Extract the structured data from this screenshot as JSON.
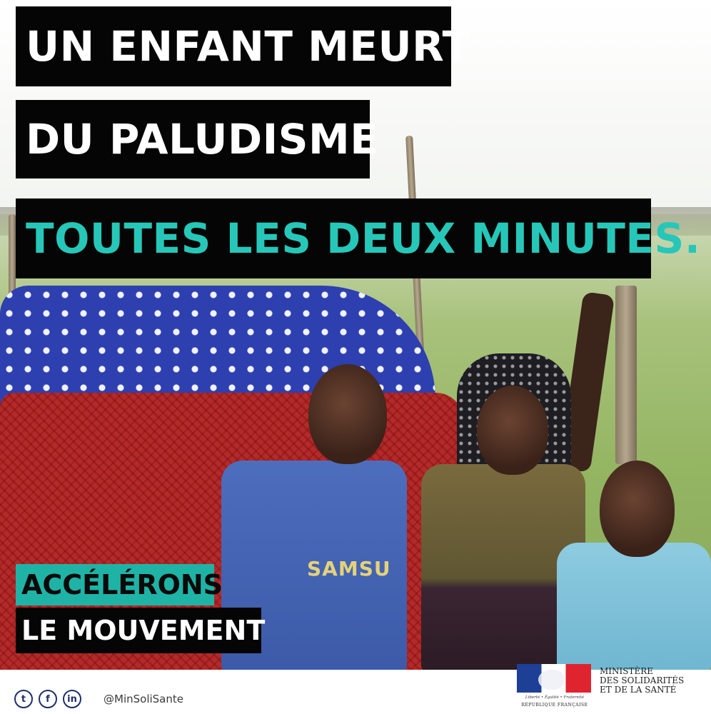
{
  "headline": {
    "line1": "UN ENFANT MEURT",
    "line2": "DU PALUDISME",
    "line3": "TOUTES LES DEUX MINUTES."
  },
  "slogan": {
    "line1": "ACCÉLÉRONS",
    "line2": "LE MOUVEMENT"
  },
  "photo": {
    "shirt_text": "SAMSU"
  },
  "footer": {
    "social_icons": [
      "twitter-icon",
      "facebook-icon",
      "linkedin-icon"
    ],
    "social_glyphs": [
      "t",
      "f",
      "in"
    ],
    "handle": "@MinSoliSante",
    "gov_motto": "Liberté • Égalité • Fraternité",
    "gov_name": "RÉPUBLIQUE FRANÇAISE",
    "ministry_lines": [
      "MINISTÈRE",
      "DES SOLIDARITÉS",
      "ET DE LA SANTÉ"
    ]
  },
  "colors": {
    "accent_teal": "#26c7b8",
    "slogan_teal": "#1fb3a6",
    "bar_black": "#050505"
  }
}
